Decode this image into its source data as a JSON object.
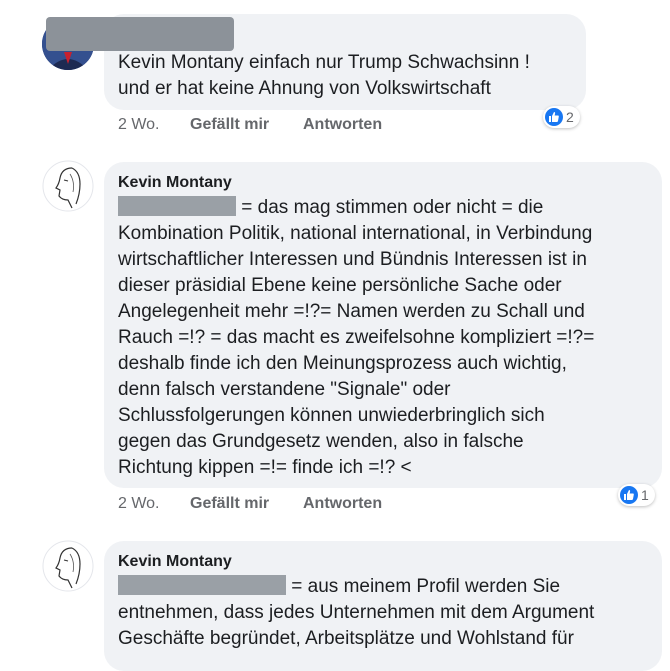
{
  "comments": [
    {
      "author_redacted": true,
      "text_lines": [
        "Kevin Montany einfach nur Trump Schwachsinn !",
        "und er hat keine Ahnung von Volkswirtschaft"
      ],
      "time": "2 Wo.",
      "like_label": "Gefällt mir",
      "reply_label": "Antworten",
      "reaction_count": "2"
    },
    {
      "author": "Kevin Montany",
      "text_lines": [
        "= das mag stimmen oder nicht = die",
        "Kombination Politik, national international, in Verbindung",
        "wirtschaftlicher Interessen und Bündnis Interessen ist in",
        "dieser präsidial Ebene keine persönliche Sache oder",
        "Angelegenheit mehr =!?= Namen werden zu Schall und",
        "Rauch =!? = das macht es zweifelsohne kompliziert =!?=",
        "deshalb finde ich den Meinungsprozess auch wichtig,",
        "denn falsch verstandene \"Signale\" oder",
        "Schlussfolgerungen können unwiederbringlich sich",
        "gegen das Grundgesetz wenden, also in falsche",
        "Richtung kippen =!= finde ich =!? <"
      ],
      "time": "2 Wo.",
      "like_label": "Gefällt mir",
      "reply_label": "Antworten",
      "reaction_count": "1"
    },
    {
      "author": "Kevin Montany",
      "text_lines": [
        "= aus meinem Profil werden Sie",
        "entnehmen, dass jedes Unternehmen mit dem Argument",
        "Geschäfte begründet, Arbeitsplätze und Wohlstand für"
      ]
    }
  ],
  "icons": {
    "reaction": "like-icon",
    "avatar_sketch": "face-sketch-icon"
  },
  "colors": {
    "bubble": "#f0f2f5",
    "like_blue": "#1877f2",
    "meta_gray": "#65676b",
    "redaction": "#9aa0a6"
  }
}
